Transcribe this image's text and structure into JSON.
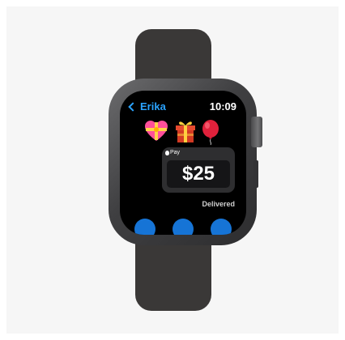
{
  "nav": {
    "back_label": "Erika"
  },
  "status": {
    "time": "10:09"
  },
  "stickers": [
    "heart-with-ribbon",
    "wrapped-gift",
    "balloon"
  ],
  "payment": {
    "label": "Pay",
    "amount": "$25",
    "status": "Delivered"
  },
  "colors": {
    "accent": "#2aa3ff",
    "action_button": "#1674d6",
    "band": "#3a3837",
    "screen": "#000000"
  }
}
